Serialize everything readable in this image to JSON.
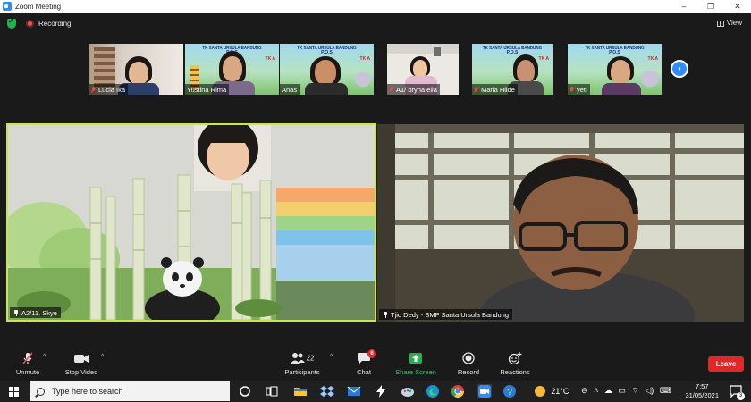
{
  "window": {
    "title": "Zoom Meeting",
    "controls": [
      "–",
      "❐",
      "✕"
    ]
  },
  "topbar": {
    "recording_label": "Recording",
    "view_label": "View"
  },
  "thumbnails": [
    {
      "name": "Lucia Ika"
    },
    {
      "name": "Yustina Rima",
      "banner_title": "TK SANTA URSULA BANDUNG",
      "banner_sub": "P.O.S",
      "banner_tag": "TK A"
    },
    {
      "name": "Anas",
      "banner_title": "TK SANTA URSULA BANDUNG",
      "banner_sub": "P.O.S",
      "banner_tag": "TK A"
    },
    {
      "name": "A1/ bryna ella"
    },
    {
      "name": "Maria Hilde",
      "banner_title": "TK SANTA URSULA BANDUNG",
      "banner_sub": "P.O.S",
      "banner_tag": "TK A"
    },
    {
      "name": "yeti",
      "banner_title": "TK SANTA URSULA BANDUNG",
      "banner_sub": "P.O.S",
      "banner_tag": "TK A"
    }
  ],
  "videos": {
    "left": {
      "name": "A2/11. Skye"
    },
    "right": {
      "name": "Tjio Dedy - SMP Santa Ursula Bandung"
    }
  },
  "controls": {
    "unmute": "Unmute",
    "stop_video": "Stop Video",
    "participants": "Participants",
    "participants_count": "22",
    "chat": "Chat",
    "chat_badge": "6",
    "share_screen": "Share Screen",
    "record": "Record",
    "reactions": "Reactions",
    "leave": "Leave"
  },
  "taskbar": {
    "search_placeholder": "Type here to search",
    "temperature": "21°C",
    "time": "7:57",
    "date": "31/05/2021",
    "notification_count": "3"
  },
  "colors": {
    "accent": "#2d8cff",
    "active_speaker_border": "#c8e54a",
    "leave": "#e02828",
    "share_screen": "#23b04f"
  }
}
